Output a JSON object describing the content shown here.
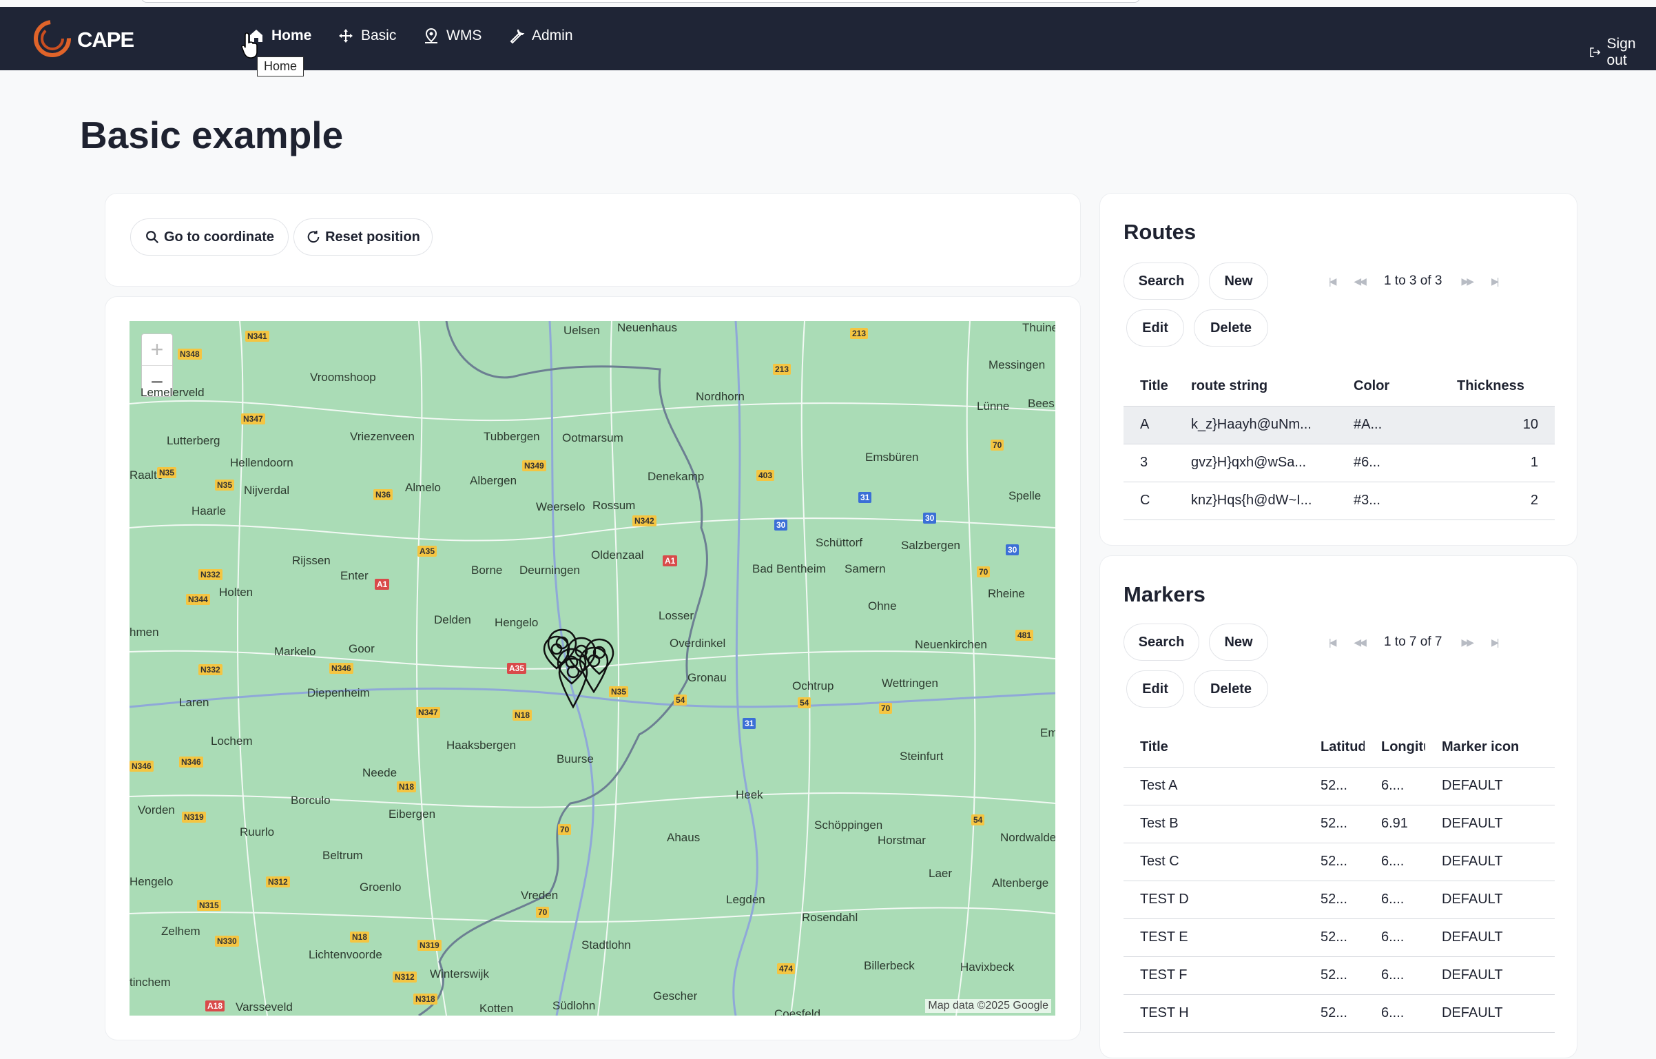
{
  "navbar": {
    "brand": "CAPE",
    "items": [
      {
        "label": "Home"
      },
      {
        "label": "Basic"
      },
      {
        "label": "WMS"
      },
      {
        "label": "Admin"
      }
    ],
    "signout": "Sign out",
    "tooltip": "Home"
  },
  "page": {
    "title": "Basic example"
  },
  "toolbar": {
    "goto": "Go to coordinate",
    "reset": "Reset position"
  },
  "map": {
    "zoom_in": "+",
    "zoom_out": "−",
    "attribution": "Map data ©2025 Google",
    "places": [
      "Uelsen",
      "Neuenhaus",
      "Thuine",
      "Messingen",
      "Lünne",
      "Bees",
      "Vroomshoop",
      "Lutterberg",
      "Vriezenveen",
      "Tubbergen",
      "Ootmarsum",
      "Nordhorn",
      "Emsbüren",
      "Hellendoorn",
      "Nijverdal",
      "Almelo",
      "Albergen",
      "Denekamp",
      "Spelle",
      "Haarle",
      "Weerselo",
      "Rossum",
      "Schüttorf",
      "Salzbergen",
      "Rijssen",
      "Enter",
      "Borne",
      "Deurningen",
      "Oldenzaal",
      "Bad Bentheim",
      "Samern",
      "Rheine",
      "Holten",
      "Ohne",
      "Delden",
      "Hengelo",
      "Losser",
      "Overdinkel",
      "Neuenkirchen",
      "Markelo",
      "Goor",
      "Gronau",
      "Diepenheim",
      "Ochtrup",
      "Wettringen",
      "Laren",
      "Lochem",
      "Haaksbergen",
      "Buurse",
      "Steinfurt",
      "Neede",
      "Borculo",
      "Eibergen",
      "Heek",
      "Vorden",
      "Ruurlo",
      "Schöppingen",
      "Horstmar",
      "Nordwalde",
      "Beltrum",
      "Ahaus",
      "Laer",
      "Altenberge",
      "Groenlo",
      "Vreden",
      "Legden",
      "Rosendahl",
      "Zelhem",
      "Lichtenvoorde",
      "Stadtlohn",
      "Winterswijk",
      "Billerbeck",
      "Havixbeck",
      "Varsseveld",
      "Kotten",
      "Südlohn",
      "Gescher",
      "Coesfeld",
      "Raalte",
      "hmen",
      "Hengelo",
      "Lemelerveld",
      "tinchem",
      "Em"
    ]
  },
  "routes": {
    "title": "Routes",
    "buttons": {
      "search": "Search",
      "new": "New",
      "edit": "Edit",
      "delete": "Delete"
    },
    "pager": "1 to 3 of 3",
    "columns": [
      "Title",
      "route string",
      "Color",
      "Thickness"
    ],
    "rows": [
      {
        "title": "A",
        "route": "k_z}Haayh@uNm...",
        "color": "#A...",
        "thickness": "10"
      },
      {
        "title": "3",
        "route": "gvz}H}qxh@wSa...",
        "color": "#6...",
        "thickness": "1"
      },
      {
        "title": "C",
        "route": "knz}Hqs{h@dW~I...",
        "color": "#3...",
        "thickness": "2"
      }
    ]
  },
  "markers": {
    "title": "Markers",
    "buttons": {
      "search": "Search",
      "new": "New",
      "edit": "Edit",
      "delete": "Delete"
    },
    "pager": "1 to 7 of 7",
    "columns": [
      "Title",
      "Latitude",
      "Longitude",
      "Marker icon"
    ],
    "rows": [
      {
        "title": "Test A",
        "lat": "52...",
        "lon": "6....",
        "icon": "DEFAULT"
      },
      {
        "title": "Test B",
        "lat": "52...",
        "lon": "6.91",
        "icon": "DEFAULT"
      },
      {
        "title": "Test C",
        "lat": "52...",
        "lon": "6....",
        "icon": "DEFAULT"
      },
      {
        "title": "TEST D",
        "lat": "52...",
        "lon": "6....",
        "icon": "DEFAULT"
      },
      {
        "title": "TEST E",
        "lat": "52...",
        "lon": "6....",
        "icon": "DEFAULT"
      },
      {
        "title": "TEST F",
        "lat": "52...",
        "lon": "6....",
        "icon": "DEFAULT"
      },
      {
        "title": "TEST H",
        "lat": "52...",
        "lon": "6....",
        "icon": "DEFAULT"
      }
    ]
  }
}
